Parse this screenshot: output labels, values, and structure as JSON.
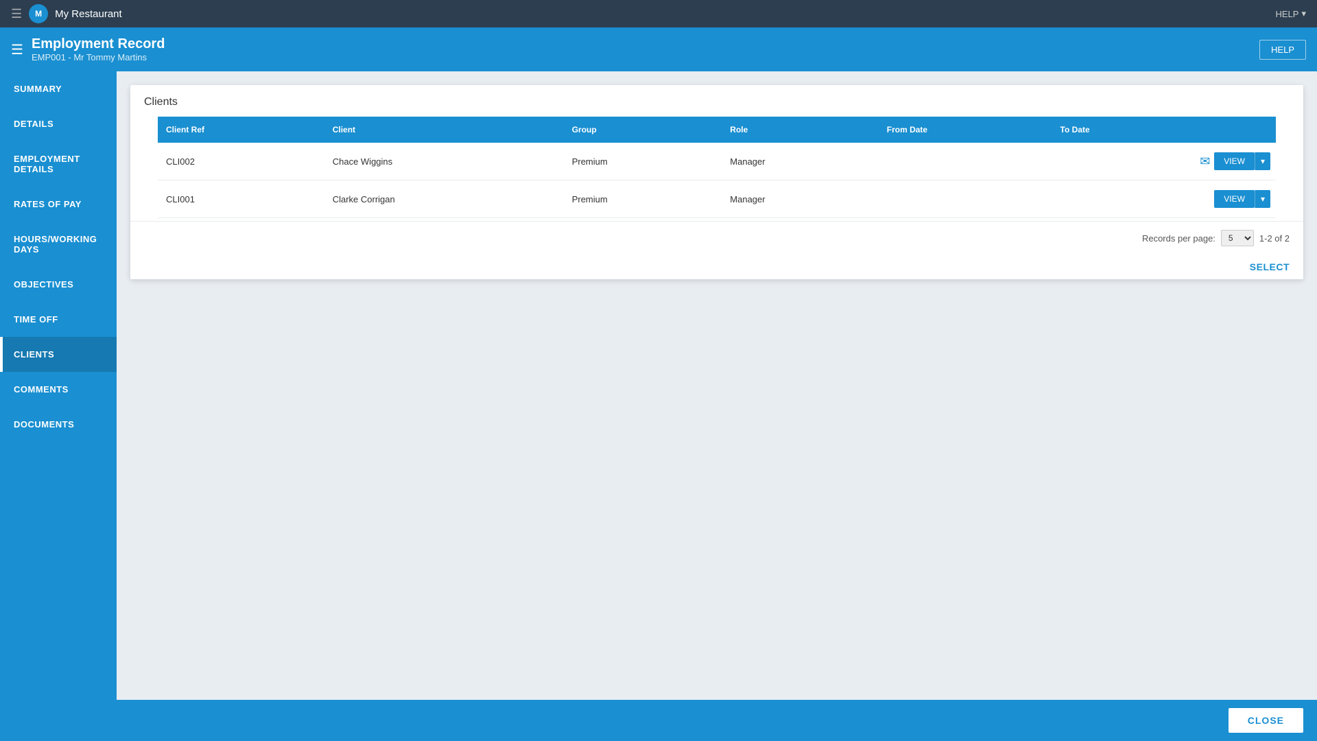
{
  "topNav": {
    "title": "My Restaurant",
    "helpLabel": "HELP"
  },
  "headerBar": {
    "title": "Employment Record",
    "subtitle": "EMP001 - Mr Tommy Martins",
    "helpLabel": "HELP"
  },
  "sidebar": {
    "items": [
      {
        "id": "summary",
        "label": "SUMMARY",
        "active": false
      },
      {
        "id": "details",
        "label": "DETAILS",
        "active": false
      },
      {
        "id": "employment-details",
        "label": "EMPLOYMENT DETAILS",
        "active": false
      },
      {
        "id": "rates-of-pay",
        "label": "RATES OF PAY",
        "active": false
      },
      {
        "id": "hours-working-days",
        "label": "HOURS/WORKING DAYS",
        "active": false
      },
      {
        "id": "objectives",
        "label": "OBJECTIVES",
        "active": false
      },
      {
        "id": "time-off",
        "label": "TIME OFF",
        "active": false
      },
      {
        "id": "clients",
        "label": "CLIENTS",
        "active": true
      },
      {
        "id": "comments",
        "label": "COMMENTS",
        "active": false
      },
      {
        "id": "documents",
        "label": "DOCUMENTS",
        "active": false
      }
    ]
  },
  "clientsSection": {
    "title": "Clients",
    "table": {
      "headers": [
        {
          "id": "client-ref",
          "label": "Client Ref"
        },
        {
          "id": "client",
          "label": "Client"
        },
        {
          "id": "group",
          "label": "Group"
        },
        {
          "id": "role",
          "label": "Role"
        },
        {
          "id": "from-date",
          "label": "From Date"
        },
        {
          "id": "to-date",
          "label": "To Date"
        },
        {
          "id": "actions",
          "label": ""
        }
      ],
      "rows": [
        {
          "clientRef": "CLI002",
          "client": "Chace Wiggins",
          "group": "Premium",
          "role": "Manager",
          "fromDate": "",
          "toDate": "",
          "hasComment": true
        },
        {
          "clientRef": "CLI001",
          "client": "Clarke Corrigan",
          "group": "Premium",
          "role": "Manager",
          "fromDate": "",
          "toDate": "",
          "hasComment": false
        }
      ]
    },
    "pagination": {
      "recordsPerPageLabel": "Records per page:",
      "recordsPerPageValue": "5",
      "rangeLabel": "1-2 of 2"
    },
    "selectLabel": "SELECT",
    "viewLabel": "VIEW"
  },
  "bottomBar": {
    "closeLabel": "CLOSE"
  }
}
